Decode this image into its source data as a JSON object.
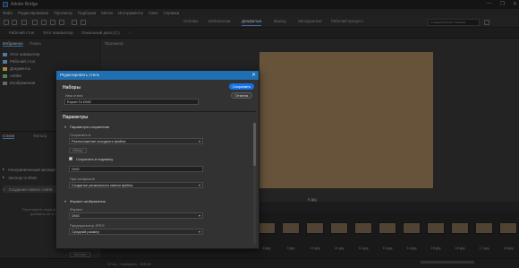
{
  "window": {
    "title": "Adobe Bridge",
    "controls": [
      "—",
      "❐",
      "✕"
    ]
  },
  "menu": [
    "Файл",
    "Редактирование",
    "Просмотр",
    "Подборки",
    "Метка",
    "Инструменты",
    "Окно",
    "Справка"
  ],
  "workspaces": [
    "Основы",
    "Библиотеки",
    "Диафильм",
    "Вывод",
    "Метаданные",
    "Рабочий процесс"
  ],
  "search_placeholder": "Сохраненные поиски",
  "breadcrumb": [
    "Рабочий стол",
    "Этот компьютер",
    "Локальный диск (C:)"
  ],
  "left_tabs": {
    "favorites": "Избранное",
    "folders": "Папки"
  },
  "favorites": [
    {
      "label": "Этот компьютер",
      "color": "#6fa1d8"
    },
    {
      "label": "Рабочий стол",
      "color": "#6fa1d8"
    },
    {
      "label": "Документы",
      "color": "#d9b94a"
    },
    {
      "label": "Adobe",
      "color": "#5fae6d"
    },
    {
      "label": "Изображения",
      "color": "#8a8a8a"
    }
  ],
  "styles_tabs": {
    "a": "Стили",
    "b": "Фильтр"
  },
  "styles": [
    "Неограниченный экспорт",
    "Экспорт в DNG",
    "Создание нового стиля"
  ],
  "styles_hint": "Перетащите сюда файлы, чтобы добавить их в очередь",
  "styles_bottom": "Экспорт",
  "preview_tab": "Просмотр",
  "preview_label": "8.jpg",
  "filmstrip": [
    "8.jpg",
    "9.jpg",
    "10.jpg",
    "11.jpg",
    "12.jpg",
    "13.jpg",
    "14.jpg",
    "15.jpg",
    "16.jpg",
    "17.jpg",
    "18.jpg",
    "19.jpg"
  ],
  "status": "47 эл., 1 выбрано - 395 КБ",
  "dialog": {
    "title": "Редактировать стиль",
    "presets_title": "Наборы",
    "style_name_label": "Имя стиля",
    "style_name_value": "Export To DNG",
    "save_label": "Сохранить",
    "cancel_label": "Отмена",
    "params_title": "Параметры",
    "save_params_title": "Параметры сохранения",
    "save_to_label": "Сохранить в",
    "save_to_value": "Расположение исходного файла",
    "browse_label": "Обзор",
    "subfolder_label": "Сохранить в подпапку",
    "subfolder_value": "DNG",
    "on_conflict_label": "При конфликте",
    "on_conflict_value": "Создание уникального имени файла",
    "format_title": "Формат изображения",
    "format_label": "Формат",
    "format_value": "DNG",
    "preview_jpeg_label": "Предпросмотр JPEG",
    "preview_jpeg_value": "Средний размер"
  },
  "colors": {
    "accent": "#1473e6",
    "dialog_titlebar": "#1f6fb2"
  }
}
